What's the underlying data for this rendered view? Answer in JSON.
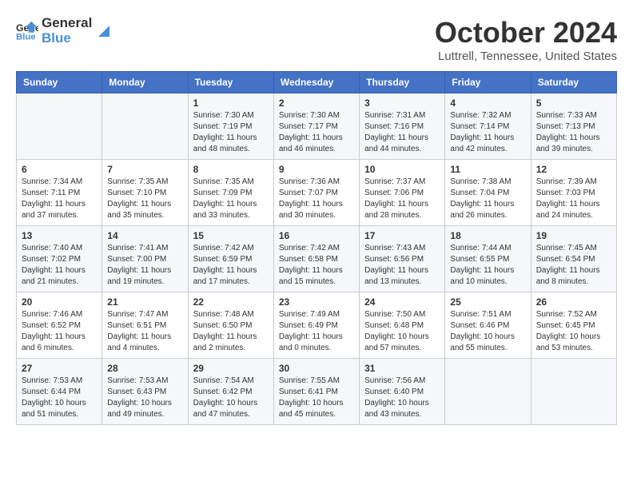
{
  "header": {
    "logo_line1": "General",
    "logo_line2": "Blue",
    "month_title": "October 2024",
    "location": "Luttrell, Tennessee, United States"
  },
  "weekdays": [
    "Sunday",
    "Monday",
    "Tuesday",
    "Wednesday",
    "Thursday",
    "Friday",
    "Saturday"
  ],
  "weeks": [
    [
      {
        "day": "",
        "info": ""
      },
      {
        "day": "",
        "info": ""
      },
      {
        "day": "1",
        "info": "Sunrise: 7:30 AM\nSunset: 7:19 PM\nDaylight: 11 hours\nand 48 minutes."
      },
      {
        "day": "2",
        "info": "Sunrise: 7:30 AM\nSunset: 7:17 PM\nDaylight: 11 hours\nand 46 minutes."
      },
      {
        "day": "3",
        "info": "Sunrise: 7:31 AM\nSunset: 7:16 PM\nDaylight: 11 hours\nand 44 minutes."
      },
      {
        "day": "4",
        "info": "Sunrise: 7:32 AM\nSunset: 7:14 PM\nDaylight: 11 hours\nand 42 minutes."
      },
      {
        "day": "5",
        "info": "Sunrise: 7:33 AM\nSunset: 7:13 PM\nDaylight: 11 hours\nand 39 minutes."
      }
    ],
    [
      {
        "day": "6",
        "info": "Sunrise: 7:34 AM\nSunset: 7:11 PM\nDaylight: 11 hours\nand 37 minutes."
      },
      {
        "day": "7",
        "info": "Sunrise: 7:35 AM\nSunset: 7:10 PM\nDaylight: 11 hours\nand 35 minutes."
      },
      {
        "day": "8",
        "info": "Sunrise: 7:35 AM\nSunset: 7:09 PM\nDaylight: 11 hours\nand 33 minutes."
      },
      {
        "day": "9",
        "info": "Sunrise: 7:36 AM\nSunset: 7:07 PM\nDaylight: 11 hours\nand 30 minutes."
      },
      {
        "day": "10",
        "info": "Sunrise: 7:37 AM\nSunset: 7:06 PM\nDaylight: 11 hours\nand 28 minutes."
      },
      {
        "day": "11",
        "info": "Sunrise: 7:38 AM\nSunset: 7:04 PM\nDaylight: 11 hours\nand 26 minutes."
      },
      {
        "day": "12",
        "info": "Sunrise: 7:39 AM\nSunset: 7:03 PM\nDaylight: 11 hours\nand 24 minutes."
      }
    ],
    [
      {
        "day": "13",
        "info": "Sunrise: 7:40 AM\nSunset: 7:02 PM\nDaylight: 11 hours\nand 21 minutes."
      },
      {
        "day": "14",
        "info": "Sunrise: 7:41 AM\nSunset: 7:00 PM\nDaylight: 11 hours\nand 19 minutes."
      },
      {
        "day": "15",
        "info": "Sunrise: 7:42 AM\nSunset: 6:59 PM\nDaylight: 11 hours\nand 17 minutes."
      },
      {
        "day": "16",
        "info": "Sunrise: 7:42 AM\nSunset: 6:58 PM\nDaylight: 11 hours\nand 15 minutes."
      },
      {
        "day": "17",
        "info": "Sunrise: 7:43 AM\nSunset: 6:56 PM\nDaylight: 11 hours\nand 13 minutes."
      },
      {
        "day": "18",
        "info": "Sunrise: 7:44 AM\nSunset: 6:55 PM\nDaylight: 11 hours\nand 10 minutes."
      },
      {
        "day": "19",
        "info": "Sunrise: 7:45 AM\nSunset: 6:54 PM\nDaylight: 11 hours\nand 8 minutes."
      }
    ],
    [
      {
        "day": "20",
        "info": "Sunrise: 7:46 AM\nSunset: 6:52 PM\nDaylight: 11 hours\nand 6 minutes."
      },
      {
        "day": "21",
        "info": "Sunrise: 7:47 AM\nSunset: 6:51 PM\nDaylight: 11 hours\nand 4 minutes."
      },
      {
        "day": "22",
        "info": "Sunrise: 7:48 AM\nSunset: 6:50 PM\nDaylight: 11 hours\nand 2 minutes."
      },
      {
        "day": "23",
        "info": "Sunrise: 7:49 AM\nSunset: 6:49 PM\nDaylight: 11 hours\nand 0 minutes."
      },
      {
        "day": "24",
        "info": "Sunrise: 7:50 AM\nSunset: 6:48 PM\nDaylight: 10 hours\nand 57 minutes."
      },
      {
        "day": "25",
        "info": "Sunrise: 7:51 AM\nSunset: 6:46 PM\nDaylight: 10 hours\nand 55 minutes."
      },
      {
        "day": "26",
        "info": "Sunrise: 7:52 AM\nSunset: 6:45 PM\nDaylight: 10 hours\nand 53 minutes."
      }
    ],
    [
      {
        "day": "27",
        "info": "Sunrise: 7:53 AM\nSunset: 6:44 PM\nDaylight: 10 hours\nand 51 minutes."
      },
      {
        "day": "28",
        "info": "Sunrise: 7:53 AM\nSunset: 6:43 PM\nDaylight: 10 hours\nand 49 minutes."
      },
      {
        "day": "29",
        "info": "Sunrise: 7:54 AM\nSunset: 6:42 PM\nDaylight: 10 hours\nand 47 minutes."
      },
      {
        "day": "30",
        "info": "Sunrise: 7:55 AM\nSunset: 6:41 PM\nDaylight: 10 hours\nand 45 minutes."
      },
      {
        "day": "31",
        "info": "Sunrise: 7:56 AM\nSunset: 6:40 PM\nDaylight: 10 hours\nand 43 minutes."
      },
      {
        "day": "",
        "info": ""
      },
      {
        "day": "",
        "info": ""
      }
    ]
  ]
}
